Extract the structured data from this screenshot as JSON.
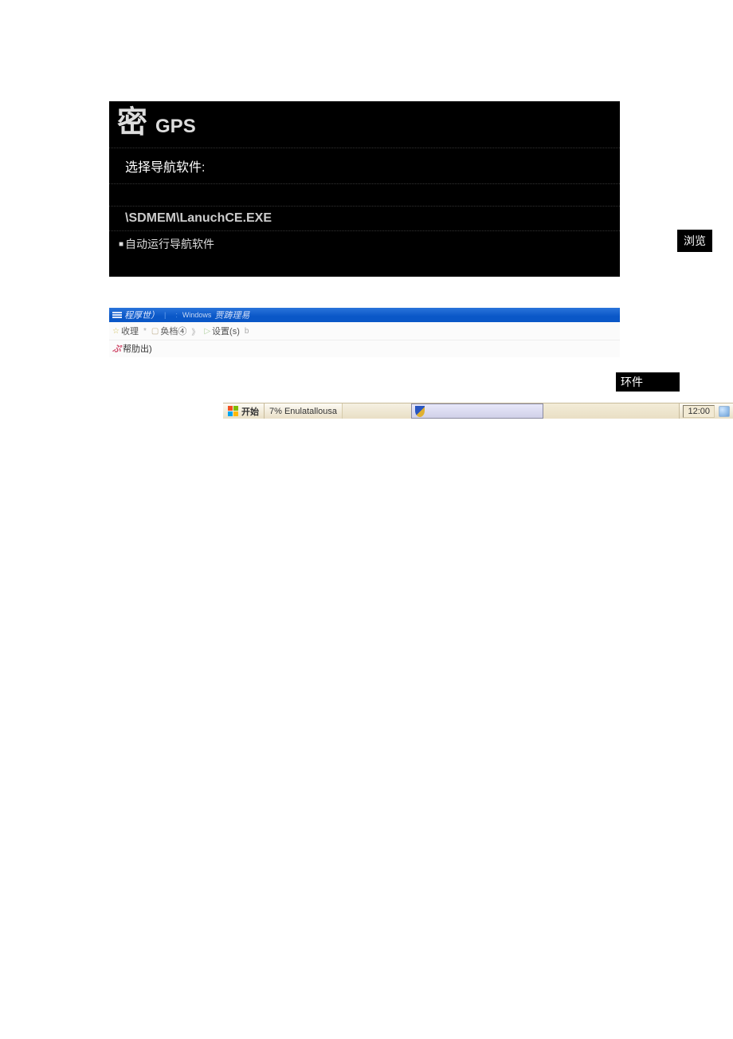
{
  "gps": {
    "logo": "密",
    "title": "GPS",
    "select_label": "选择导航软件:",
    "path": "\\SDMEM\\LanuchCE.EXE",
    "auto_run_label": "自动运行导航软件",
    "browse_label": "浏览"
  },
  "app": {
    "titlebar": {
      "text1": "程厚世）",
      "divider": "|",
      "win_label": "Windows",
      "text2": "贾踌理易"
    },
    "toolbar": {
      "item1": "收理",
      "sep1": "*",
      "item2": "奂档④",
      "sep2": "》",
      "item3": "设置(s)",
      "sep3": "b"
    },
    "toolbar2": {
      "item1": "帮肋出)"
    }
  },
  "ring_badge": "环件",
  "taskbar": {
    "start": "开始",
    "task_item": "7% Enulatallousa",
    "time": "12:00"
  }
}
